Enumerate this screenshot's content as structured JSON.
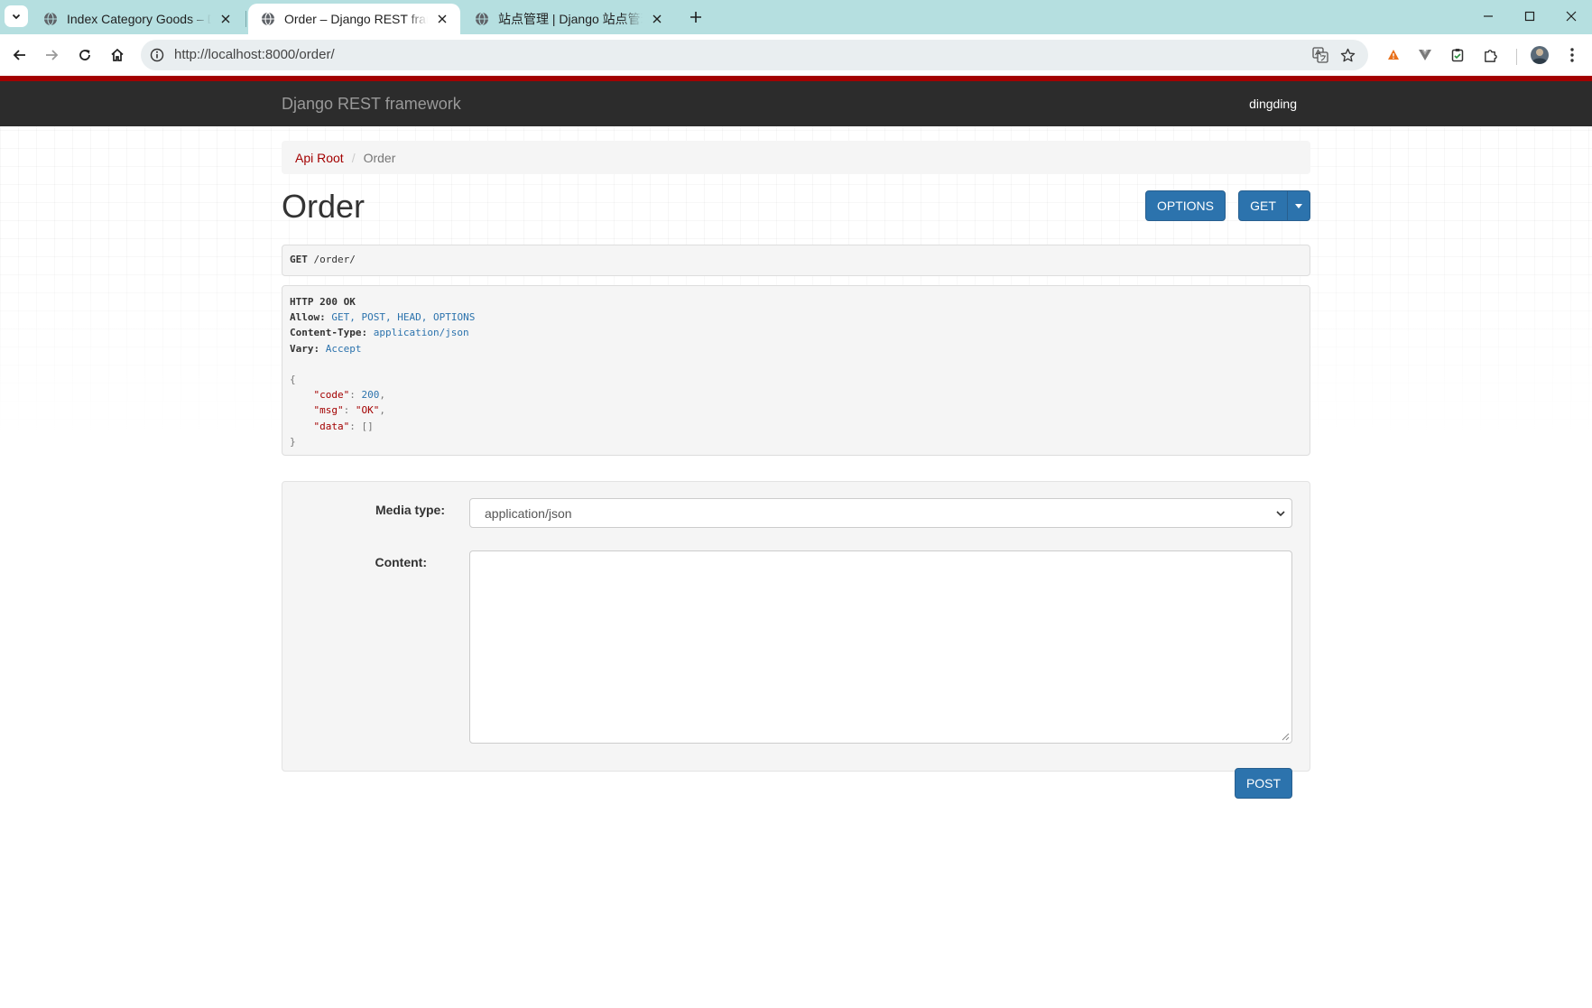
{
  "browser": {
    "tabs": [
      {
        "title": "Index Category Goods – Django REST framework",
        "active": false
      },
      {
        "title": "Order – Django REST framework",
        "active": true
      },
      {
        "title": "站点管理 | Django 站点管理员",
        "active": false
      }
    ],
    "url": "http://localhost:8000/order/",
    "icons": {
      "tab_menu": "chevron-down-icon",
      "new_tab": "plus-icon",
      "back": "arrow-left-icon",
      "forward": "arrow-right-icon",
      "reload": "reload-icon",
      "home": "home-icon",
      "site_info": "info-icon",
      "translate": "translate-icon",
      "bookmark": "star-icon",
      "extensions": "puzzle-icon",
      "profile": "avatar-icon",
      "menu": "kebab-menu-icon"
    }
  },
  "navbar": {
    "brand": "Django REST framework",
    "user": "dingding"
  },
  "breadcrumb": {
    "root": "Api Root",
    "separator": "/",
    "current": "Order"
  },
  "page": {
    "title": "Order",
    "buttons": {
      "options": "OPTIONS",
      "get": "GET",
      "post": "POST"
    }
  },
  "request": {
    "method": "GET",
    "path": "/order/"
  },
  "response": {
    "status": "HTTP 200 OK",
    "headers": [
      {
        "name": "Allow:",
        "value": "GET, POST, HEAD, OPTIONS"
      },
      {
        "name": "Content-Type:",
        "value": "application/json"
      },
      {
        "name": "Vary:",
        "value": "Accept"
      }
    ],
    "body": {
      "open": "{",
      "close": "}",
      "lines": [
        {
          "key": "\"code\"",
          "value": "200",
          "trail": ","
        },
        {
          "key": "\"msg\"",
          "value": "\"OK\"",
          "trail": ","
        },
        {
          "key": "\"data\"",
          "value": "[]",
          "trail": ""
        }
      ]
    }
  },
  "form": {
    "media_type_label": "Media type:",
    "media_type_value": "application/json",
    "content_label": "Content:",
    "content_value": ""
  },
  "colors": {
    "accent_red": "#a30000",
    "primary_blue": "#2c73ad",
    "navbar_bg": "#2c2c2c",
    "tabbar_bg": "#b5dfe0"
  }
}
